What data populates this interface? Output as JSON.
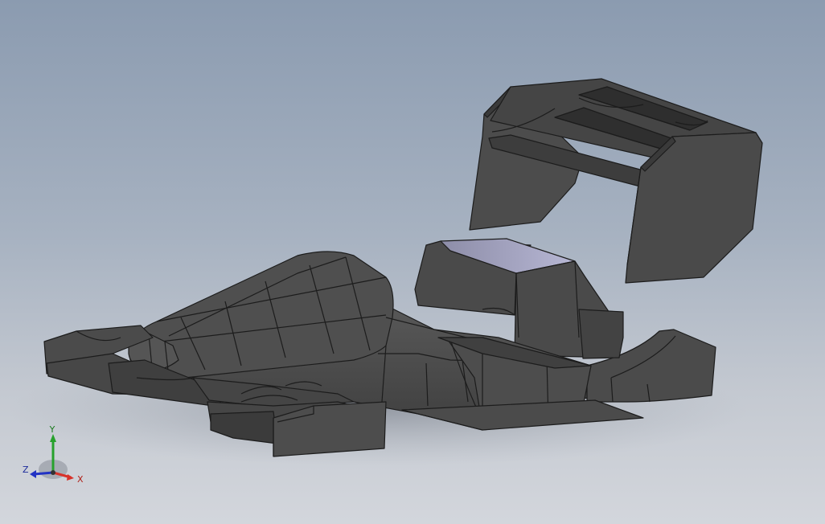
{
  "viewport": {
    "background_top": "#8b9bb0",
    "background_bottom": "#d3d6dc"
  },
  "model": {
    "part_color": "#4a4a4a",
    "edge_color": "#1c1c1c",
    "highlight_face_color": "#a9a9c9"
  },
  "triad": {
    "x_label": "X",
    "y_label": "Y",
    "z_label": "Z",
    "x_color": "#d8322a",
    "y_color": "#27a12c",
    "z_color": "#2233c4"
  }
}
